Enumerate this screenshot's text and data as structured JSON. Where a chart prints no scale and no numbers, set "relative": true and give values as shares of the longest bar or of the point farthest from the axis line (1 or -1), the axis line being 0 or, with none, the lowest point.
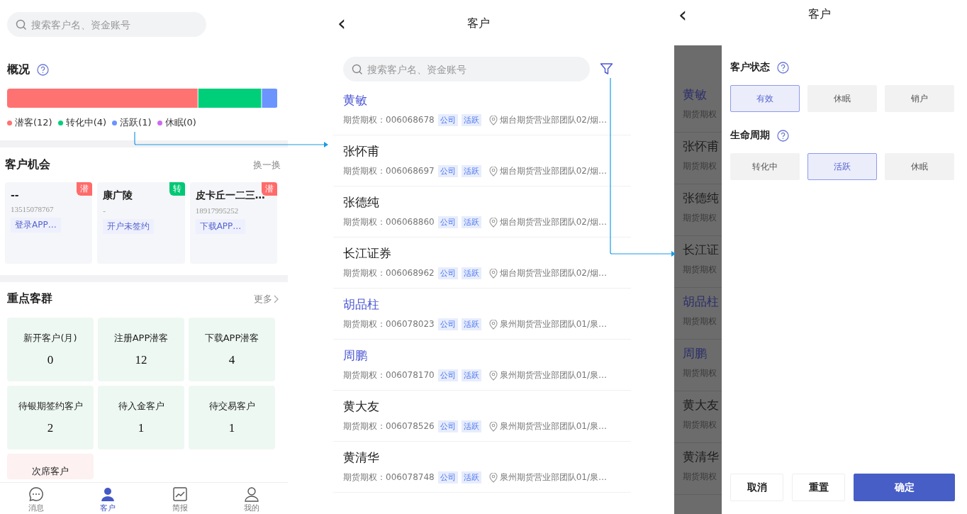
{
  "home": {
    "search": {
      "placeholder": "搜索客户名、资金账号"
    },
    "overview": {
      "title": "概况",
      "chart_data": {
        "type": "bar",
        "orientation": "horizontal",
        "stacked": true,
        "relative": true,
        "series": [
          {
            "color": "#ff7272",
            "values": [
              0.706
            ]
          },
          {
            "color": "#00cf7a",
            "values": [
              0.235
            ]
          },
          {
            "color": "#6b94ff",
            "values": [
              0.059
            ]
          },
          {
            "color": "#cc6bf0",
            "values": [
              0
            ]
          }
        ]
      },
      "segments": [
        {
          "label": "潜客(12)",
          "color": "#ff7272"
        },
        {
          "label": "转化中(4)",
          "color": "#00cf7a"
        },
        {
          "label": "活跃(1)",
          "color": "#6b94ff"
        },
        {
          "label": "休眠(0)",
          "color": "#cc6bf0"
        }
      ]
    },
    "opportunities": {
      "title": "客户机会",
      "action": "换一换",
      "cards": [
        {
          "name": "--",
          "phone": "13515078767",
          "tag": "登录APP…",
          "badge": "潜",
          "color": "#ff6b6b"
        },
        {
          "name": "康广陵",
          "phone": "-",
          "tag": "开户未签约",
          "badge": "转",
          "color": "#00c875"
        },
        {
          "name": "皮卡丘一二三…",
          "phone": "18917995252",
          "tag": "下载APP…",
          "badge": "潜",
          "color": "#ff6b6b"
        }
      ]
    },
    "groups": {
      "title": "重点客群",
      "action": "更多",
      "items": [
        {
          "label": "新开客户(月)",
          "count": "0",
          "color": "#eef8f2"
        },
        {
          "label": "注册APP潜客",
          "count": "12",
          "color": "#eef8f2"
        },
        {
          "label": "下载APP潜客",
          "count": "4",
          "color": "#eef8f2"
        },
        {
          "label": "待银期签约客户",
          "count": "2",
          "color": "#eef8f2"
        },
        {
          "label": "待入金客户",
          "count": "1",
          "color": "#eef8f2"
        },
        {
          "label": "待交易客户",
          "count": "1",
          "color": "#eef8f2"
        },
        {
          "label": "次席客户",
          "color": "#fdf1f1"
        }
      ]
    },
    "tabbar": [
      {
        "label": "消息",
        "kind": "chat",
        "selected": false
      },
      {
        "label": "客户",
        "kind": "person",
        "selected": true
      },
      {
        "label": "简报",
        "kind": "chart",
        "selected": false
      },
      {
        "label": "我的",
        "kind": "user",
        "selected": false
      }
    ]
  },
  "list": {
    "back": "‹",
    "title": "客户",
    "search": {
      "placeholder": "搜索客户名、资金账号"
    },
    "rows": [
      {
        "name": "黄敏",
        "highlighted": true,
        "account": "期货期权：006068678",
        "tags": [
          "公司",
          "活跃"
        ],
        "location": "烟台期货营业部团队02/烟…"
      },
      {
        "name": "张怀甫",
        "highlighted": false,
        "account": "期货期权：006068697",
        "tags": [
          "公司",
          "活跃"
        ],
        "location": "烟台期货营业部团队02/烟…"
      },
      {
        "name": "张德纯",
        "highlighted": false,
        "account": "期货期权：006068860",
        "tags": [
          "公司",
          "活跃"
        ],
        "location": "烟台期货营业部团队02/烟…"
      },
      {
        "name": "长江证券",
        "highlighted": false,
        "account": "期货期权：006068962",
        "tags": [
          "公司",
          "活跃"
        ],
        "location": "烟台期货营业部团队02/烟…"
      },
      {
        "name": "胡品柱",
        "highlighted": true,
        "account": "期货期权：006078023",
        "tags": [
          "公司",
          "活跃"
        ],
        "location": "泉州期货营业部团队01/泉…"
      },
      {
        "name": "周鹏",
        "highlighted": true,
        "account": "期货期权：006078170",
        "tags": [
          "公司",
          "活跃"
        ],
        "location": "泉州期货营业部团队01/泉…"
      },
      {
        "name": "黄大友",
        "highlighted": false,
        "account": "期货期权：006078526",
        "tags": [
          "公司",
          "活跃"
        ],
        "location": "泉州期货营业部团队01/泉…"
      },
      {
        "name": "黄清华",
        "highlighted": false,
        "account": "期货期权：006078748",
        "tags": [
          "公司",
          "活跃"
        ],
        "location": "泉州期货营业部团队01/泉…"
      }
    ]
  },
  "filter": {
    "back": "‹",
    "title": "客户",
    "behind": [
      {
        "name": "黄敏",
        "highlighted": true,
        "account": "期货期权"
      },
      {
        "name": "张怀甫",
        "highlighted": false,
        "account": "期货期权"
      },
      {
        "name": "张德纯",
        "highlighted": false,
        "account": "期货期权"
      },
      {
        "name": "长江证",
        "highlighted": false,
        "account": "期货期权"
      },
      {
        "name": "胡品柱",
        "highlighted": true,
        "account": "期货期权"
      },
      {
        "name": "周鹏",
        "highlighted": true,
        "account": "期货期权"
      },
      {
        "name": "黄大友",
        "highlighted": false,
        "account": "期货期权"
      },
      {
        "name": "黄清华",
        "highlighted": false,
        "account": "期货期权"
      }
    ],
    "sections": [
      {
        "title": "客户状态",
        "options": [
          {
            "label": "有效",
            "selected": true
          },
          {
            "label": "休眠",
            "selected": false
          },
          {
            "label": "销户",
            "selected": false
          }
        ]
      },
      {
        "title": "生命周期",
        "options": [
          {
            "label": "转化中",
            "selected": false
          },
          {
            "label": "活跃",
            "selected": true
          },
          {
            "label": "休眠",
            "selected": false
          }
        ]
      }
    ],
    "buttons": [
      {
        "label": "取消",
        "kind": "plain"
      },
      {
        "label": "重置",
        "kind": "plain"
      },
      {
        "label": "确定",
        "kind": "primary"
      }
    ]
  }
}
